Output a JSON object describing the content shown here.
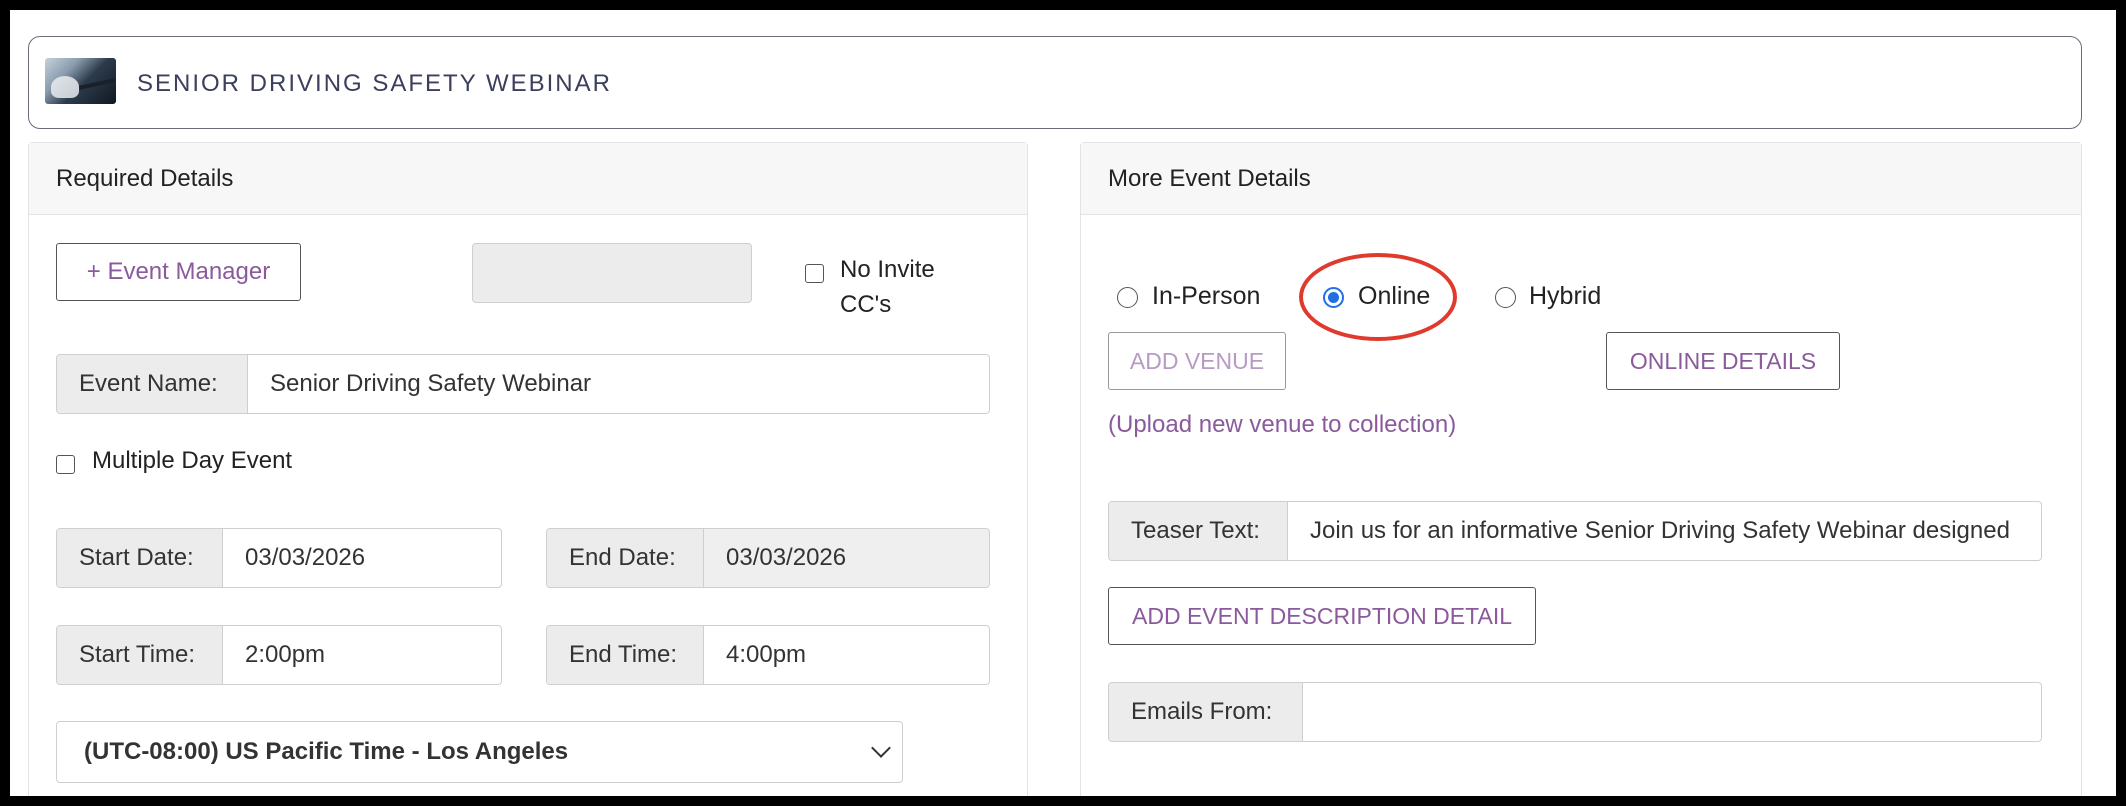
{
  "header": {
    "title": "SENIOR DRIVING SAFETY WEBINAR",
    "thumbnail": "event-thumbnail-image"
  },
  "required": {
    "heading": "Required Details",
    "event_manager_button": "+ Event Manager",
    "no_invite_cc_label_line1": "No Invite",
    "no_invite_cc_label_line2": "CC's",
    "no_invite_cc_checked": false,
    "event_name_label": "Event Name:",
    "event_name_value": "Senior Driving Safety Webinar",
    "multiple_day_label": "Multiple Day Event",
    "multiple_day_checked": false,
    "start_date_label": "Start Date:",
    "start_date_value": "03/03/2026",
    "end_date_label": "End Date:",
    "end_date_value": "03/03/2026",
    "start_time_label": "Start Time:",
    "start_time_value": "2:00pm",
    "end_time_label": "End Time:",
    "end_time_value": "4:00pm",
    "timezone_value": "(UTC-08:00) US Pacific Time - Los Angeles"
  },
  "more": {
    "heading": "More Event Details",
    "location_options": [
      "In-Person",
      "Online",
      "Hybrid"
    ],
    "location_selected": "Online",
    "add_venue_button": "ADD VENUE",
    "online_details_button": "ONLINE DETAILS",
    "upload_venue_link": "(Upload new venue to collection)",
    "teaser_label": "Teaser Text:",
    "teaser_value": "Join us for an informative Senior Driving Safety Webinar designed",
    "add_description_button": "ADD EVENT DESCRIPTION DETAIL",
    "emails_from_label": "Emails From:",
    "emails_from_value": ""
  },
  "colors": {
    "accent_purple": "#8a5a9c",
    "radio_blue": "#1f6fe5",
    "highlight_red": "#e03a2f"
  }
}
